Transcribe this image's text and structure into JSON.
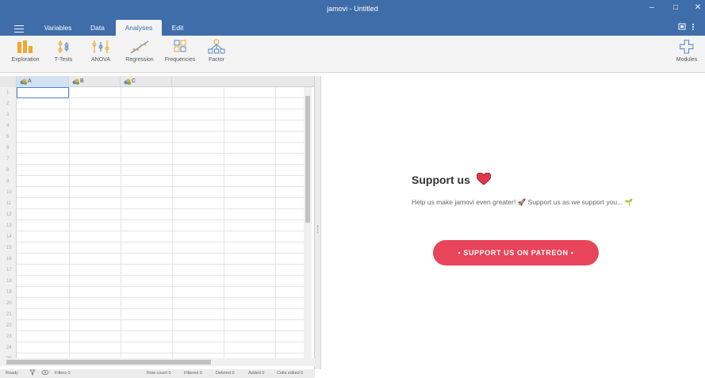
{
  "window": {
    "title": "jamovi - Untitled",
    "minimize": "–",
    "maximize": "□",
    "close": "✕"
  },
  "menu": {
    "tabs": [
      {
        "label": "Variables"
      },
      {
        "label": "Data"
      },
      {
        "label": "Analyses",
        "active": true
      },
      {
        "label": "Edit"
      }
    ]
  },
  "ribbon": {
    "buttons": [
      {
        "label": "Exploration",
        "icon": "exploration-icon"
      },
      {
        "label": "T-Tests",
        "icon": "ttests-icon"
      },
      {
        "label": "ANOVA",
        "icon": "anova-icon"
      },
      {
        "label": "Regression",
        "icon": "regression-icon"
      },
      {
        "label": "Frequencies",
        "icon": "frequencies-icon"
      },
      {
        "label": "Factor",
        "icon": "factor-icon"
      }
    ],
    "modules_label": "Modules"
  },
  "sheet": {
    "columns": [
      "A",
      "B",
      "C"
    ],
    "rows": [
      "1",
      "2",
      "3",
      "4",
      "5",
      "6",
      "7",
      "8",
      "9",
      "10",
      "11",
      "12",
      "13",
      "14",
      "15",
      "16",
      "17",
      "18",
      "19",
      "20",
      "21",
      "22",
      "23",
      "24",
      "25"
    ]
  },
  "status": {
    "ready": "Ready",
    "filters": "Filters 0",
    "row_count": "Row count 0",
    "filtered": "Filtered 0",
    "deleted": "Deleted 0",
    "added": "Added 0",
    "cells_edited": "Cells edited 0"
  },
  "results": {
    "title": "Support us",
    "text": "Help us make jamovi even greater! 🚀 Support us as we support you... 🌱",
    "button": "• SUPPORT US ON PATREON •"
  },
  "colors": {
    "accent": "#3e6da9",
    "patreon": "#e8445a",
    "heart": "#e0384a"
  }
}
